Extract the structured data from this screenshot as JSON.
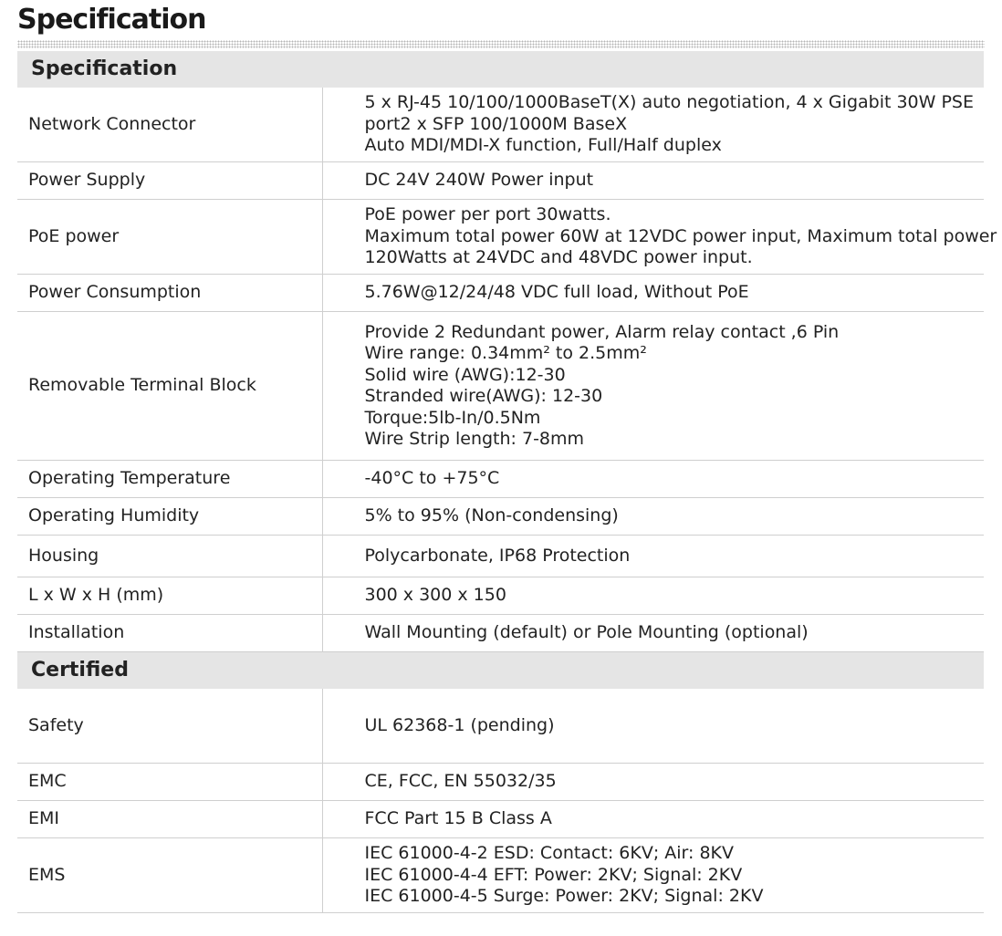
{
  "page_title": "Specification",
  "sections": [
    {
      "heading": "Specification",
      "rows": [
        {
          "label": "Network Connector",
          "value": [
            "5 x RJ-45 10/100/1000BaseT(X) auto negotiation, 4 x Gigabit 30W PSE",
            "port2 x SFP 100/1000M BaseX",
            "Auto MDI/MDI-X function, Full/Half duplex"
          ]
        },
        {
          "label": "Power Supply",
          "value": [
            "DC 24V 240W Power input"
          ]
        },
        {
          "label": "PoE power",
          "value": [
            "PoE power per port 30watts.",
            "Maximum total power 60W at 12VDC power input, Maximum total power",
            "120Watts at 24VDC and 48VDC power input."
          ]
        },
        {
          "label": "Power Consumption",
          "value": [
            "5.76W@12/24/48 VDC full load, Without PoE"
          ]
        },
        {
          "label": "Removable Terminal Block",
          "value": [
            "Provide 2 Redundant power, Alarm relay contact ,6 Pin",
            "Wire range: 0.34mm² to 2.5mm²",
            "Solid wire (AWG):12-30",
            "Stranded wire(AWG): 12-30",
            "Torque:5lb-In/0.5Nm",
            "Wire Strip length: 7-8mm"
          ]
        },
        {
          "label": "Operating Temperature",
          "value": [
            "-40°C to +75°C"
          ]
        },
        {
          "label": "Operating Humidity",
          "value": [
            "5% to 95% (Non-condensing)"
          ]
        },
        {
          "label": "Housing",
          "value": [
            "Polycarbonate, IP68 Protection"
          ]
        },
        {
          "label": "L x W x H (mm)",
          "value": [
            "300 x 300 x 150"
          ]
        },
        {
          "label": "Installation",
          "value": [
            "Wall Mounting (default) or Pole Mounting (optional)"
          ]
        }
      ]
    },
    {
      "heading": "Certified",
      "rows": [
        {
          "label": "Safety",
          "value": [
            "UL 62368-1 (pending)"
          ]
        },
        {
          "label": "EMC",
          "value": [
            "CE, FCC, EN 55032/35"
          ]
        },
        {
          "label": "EMI",
          "value": [
            "FCC Part 15 B Class A"
          ]
        },
        {
          "label": "EMS",
          "value": [
            "IEC 61000-4-2 ESD: Contact: 6KV; Air: 8KV",
            "IEC 61000-4-4 EFT: Power: 2KV; Signal: 2KV",
            "IEC 61000-4-5 Surge: Power: 2KV; Signal: 2KV"
          ]
        }
      ]
    }
  ]
}
